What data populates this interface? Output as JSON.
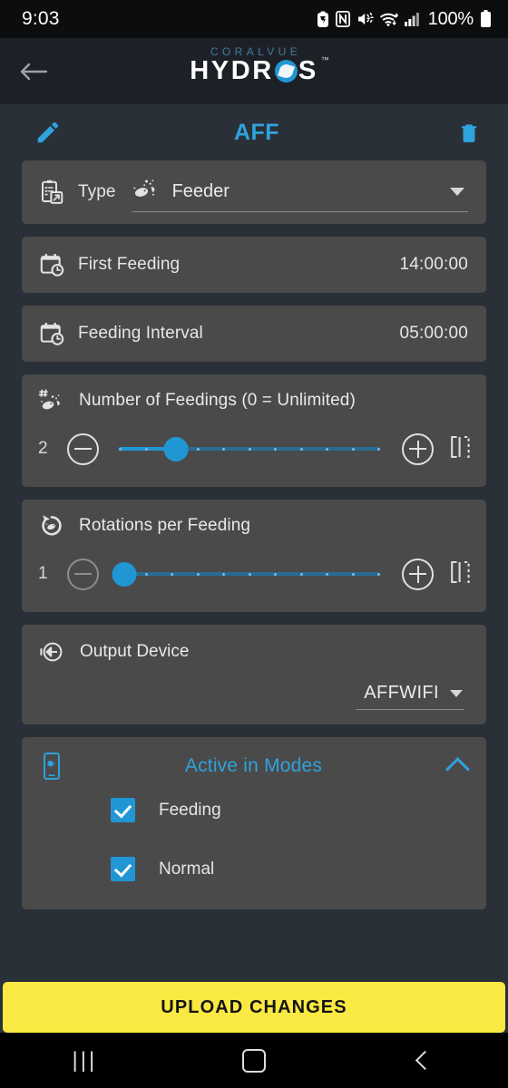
{
  "status_bar": {
    "time": "9:03",
    "battery_percent": "100%",
    "icons": [
      "eco-icon",
      "nfc-icon",
      "mute-icon",
      "wifi-icon",
      "signal-icon",
      "battery-icon"
    ]
  },
  "app_bar": {
    "back_icon": "back-arrow-icon",
    "brand_top": "CORALVUE",
    "brand_main_part1": "HYDR",
    "brand_main_part2": "S",
    "trademark": "™"
  },
  "title_row": {
    "edit_icon": "pencil-icon",
    "title": "AFF",
    "delete_icon": "trash-icon",
    "accent_color": "#2ea3dd"
  },
  "type_card": {
    "icon": "clipboard-export-icon",
    "label": "Type",
    "value_icon": "fish-food-icon",
    "value": "Feeder",
    "caret": "chevron-down-icon"
  },
  "rows": [
    {
      "icon": "calendar-clock-icon",
      "label": "First Feeding",
      "value": "14:00:00"
    },
    {
      "icon": "calendar-clock-icon",
      "label": "Feeding Interval",
      "value": "05:00:00"
    }
  ],
  "sliders": [
    {
      "icon": "hash-fish-icon",
      "title": "Number of Feedings (0 = Unlimited)",
      "value": "2",
      "percent": 22,
      "tick_count": 11,
      "minus_enabled": true,
      "minus_icon": "minus-circle-icon",
      "plus_icon": "plus-circle-icon",
      "keypad_icon": "numeric-input-icon",
      "fill_color": "#2196d4",
      "track_color": "#2a6b92"
    },
    {
      "icon": "rotation-fish-icon",
      "title": "Rotations per Feeding",
      "value": "1",
      "percent": 0,
      "tick_count": 11,
      "minus_enabled": false,
      "minus_icon": "minus-circle-icon",
      "plus_icon": "plus-circle-icon",
      "keypad_icon": "numeric-input-icon",
      "fill_color": "#2196d4",
      "track_color": "#2a6b92"
    }
  ],
  "output_device": {
    "icon": "output-arrow-icon",
    "label": "Output Device",
    "value": "AFFWIFI",
    "caret": "chevron-down-icon"
  },
  "modes": {
    "icon": "device-moon-icon",
    "title": "Active in Modes",
    "collapse_icon": "chevron-up-icon",
    "items": [
      {
        "label": "Feeding",
        "checked": true
      },
      {
        "label": "Normal",
        "checked": true
      }
    ]
  },
  "upload_button": {
    "label": "UPLOAD CHANGES",
    "background": "#fae942",
    "text_color": "#151515"
  },
  "nav_bar": {
    "recents_icon": "recents-icon",
    "recents_glyph": "|||",
    "home_icon": "home-icon",
    "back_icon": "nav-back-icon"
  }
}
